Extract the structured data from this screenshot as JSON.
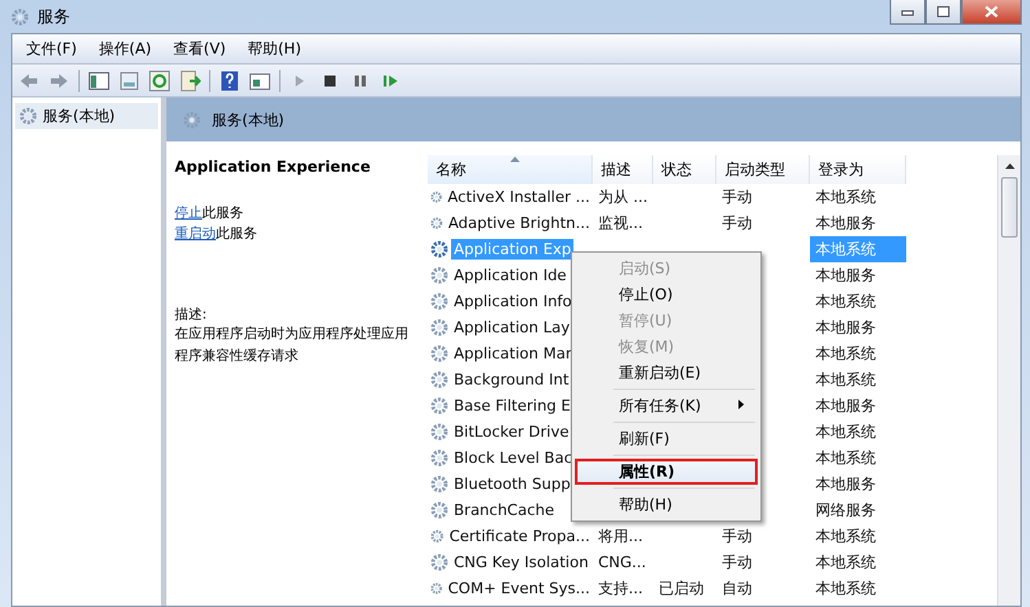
{
  "window": {
    "title": "服务"
  },
  "menu_bar": [
    "文件(F)",
    "操作(A)",
    "查看(V)",
    "帮助(H)"
  ],
  "tree": {
    "items": [
      {
        "label": "服务(本地)",
        "selected": true
      }
    ]
  },
  "panel": {
    "title": "服务(本地)"
  },
  "details": {
    "service_name": "Application Experience",
    "actions": [
      {
        "link": "停止",
        "text": "此服务"
      },
      {
        "link": "重启动",
        "text": "此服务"
      }
    ],
    "description_label": "描述:",
    "description": "在应用程序启动时为应用程序处理应用程序兼容性缓存请求"
  },
  "table": {
    "columns": [
      {
        "label": "名称",
        "sorted": true
      },
      {
        "label": "描述",
        "sorted": false
      },
      {
        "label": "状态",
        "sorted": false
      },
      {
        "label": "启动类型",
        "sorted": false
      },
      {
        "label": "登录为",
        "sorted": false
      }
    ],
    "rows": [
      {
        "cells": [
          "ActiveX Installer ...",
          "为从 ...",
          "",
          "手动",
          "本地系统"
        ],
        "selected": false
      },
      {
        "cells": [
          "Adaptive Brightn...",
          "监视...",
          "",
          "手动",
          "本地服务"
        ],
        "selected": false
      },
      {
        "cells": [
          "Application Exp",
          "",
          "",
          "",
          "本地系统"
        ],
        "selected": true
      },
      {
        "cells": [
          "Application Ide",
          "",
          "",
          "",
          "本地服务"
        ],
        "selected": false
      },
      {
        "cells": [
          "Application Info",
          "",
          "",
          "",
          "本地系统"
        ],
        "selected": false
      },
      {
        "cells": [
          "Application Lay",
          "",
          "",
          "",
          "本地服务"
        ],
        "selected": false
      },
      {
        "cells": [
          "Application Mar",
          "",
          "",
          "",
          "本地系统"
        ],
        "selected": false
      },
      {
        "cells": [
          "Background Int",
          "",
          "",
          "",
          "本地系统"
        ],
        "selected": false
      },
      {
        "cells": [
          "Base Filtering E",
          "",
          "",
          "",
          "本地服务"
        ],
        "selected": false
      },
      {
        "cells": [
          "BitLocker Drive",
          "",
          "",
          "",
          "本地系统"
        ],
        "selected": false
      },
      {
        "cells": [
          "Block Level Bac",
          "",
          "",
          "",
          "本地系统"
        ],
        "selected": false
      },
      {
        "cells": [
          "Bluetooth Supp",
          "",
          "",
          "",
          "本地服务"
        ],
        "selected": false
      },
      {
        "cells": [
          "BranchCache",
          "",
          "",
          "",
          "网络服务"
        ],
        "selected": false
      },
      {
        "cells": [
          "Certificate Propa...",
          "将用...",
          "",
          "手动",
          "本地系统"
        ],
        "selected": false
      },
      {
        "cells": [
          "CNG Key Isolation",
          "CNG...",
          "",
          "手动",
          "本地系统"
        ],
        "selected": false
      },
      {
        "cells": [
          "COM+ Event Sys...",
          "支持...",
          "已启动",
          "自动",
          "本地系统"
        ],
        "selected": false
      }
    ]
  },
  "context_menu": {
    "items": [
      {
        "kind": "item",
        "label": "启动(S)",
        "disabled": true,
        "highlighted": false
      },
      {
        "kind": "item",
        "label": "停止(O)",
        "disabled": false,
        "highlighted": false
      },
      {
        "kind": "item",
        "label": "暂停(U)",
        "disabled": true,
        "highlighted": false
      },
      {
        "kind": "item",
        "label": "恢复(M)",
        "disabled": true,
        "highlighted": false
      },
      {
        "kind": "item",
        "label": "重新启动(E)",
        "disabled": false,
        "highlighted": false
      },
      {
        "kind": "separator"
      },
      {
        "kind": "submenu",
        "label": "所有任务(K)",
        "disabled": false,
        "highlighted": false
      },
      {
        "kind": "separator"
      },
      {
        "kind": "item",
        "label": "刷新(F)",
        "disabled": false,
        "highlighted": false
      },
      {
        "kind": "separator"
      },
      {
        "kind": "item",
        "label": "属性(R)",
        "disabled": false,
        "highlighted": true
      },
      {
        "kind": "separator"
      },
      {
        "kind": "item",
        "label": "帮助(H)",
        "disabled": false,
        "highlighted": false
      }
    ]
  }
}
